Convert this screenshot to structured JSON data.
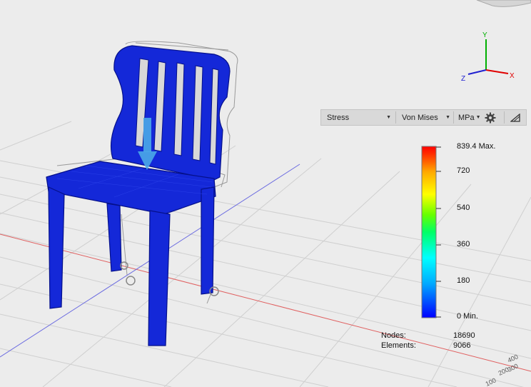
{
  "toolbar": {
    "result_type": "Stress",
    "criterion": "Von Mises",
    "units": "MPa",
    "settings_icon": "gear-icon",
    "probe_icon": "triangle-probe-icon"
  },
  "legend": {
    "max_label": "839.4 Max.",
    "ticks": [
      "720",
      "540",
      "360",
      "180"
    ],
    "min_label": "0 Min.",
    "max_value": 839.4,
    "min_value": 0,
    "colors": [
      "#0000ff",
      "#00aaff",
      "#00ffff",
      "#00ff66",
      "#66ff00",
      "#ffff00",
      "#ffaa00",
      "#ff3300",
      "#ff0000"
    ]
  },
  "stats": {
    "nodes_label": "Nodes:",
    "nodes_value": "18690",
    "elements_label": "Elements:",
    "elements_value": "9066"
  },
  "axes": {
    "x": "X",
    "y": "Y",
    "z": "Z"
  },
  "grid_labels": [
    "400",
    "300",
    "200",
    "100"
  ],
  "colors": {
    "background": "#ececec",
    "grid": "#cfcfcf",
    "x_axis": "#e06060",
    "z_axis": "#6a6ae0",
    "chair": "#1428d8",
    "load_arrow": "#4aa8e8"
  }
}
